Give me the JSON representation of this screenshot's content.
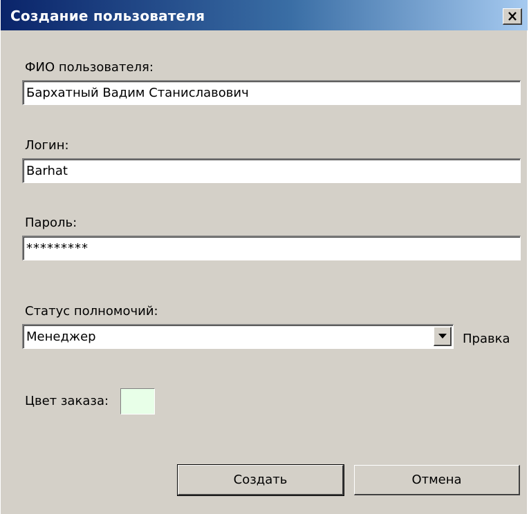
{
  "window": {
    "title": "Создание пользователя",
    "close_label": "×"
  },
  "form": {
    "fio_label": "ФИО пользователя:",
    "fio_value": "Бархатный Вадим Станиславович",
    "login_label": "Логин:",
    "login_value": "Barhat",
    "password_label": "Пароль:",
    "password_value": "*********",
    "status_label": "Статус полномочий:",
    "status_value": "Менеджер",
    "edit_link": "Правка",
    "color_label": "Цвет заказа:",
    "order_color": "#e8ffe8"
  },
  "buttons": {
    "create": "Создать",
    "cancel": "Отмена"
  },
  "icons": {
    "close": "close-icon",
    "dropdown": "chevron-down-icon"
  }
}
